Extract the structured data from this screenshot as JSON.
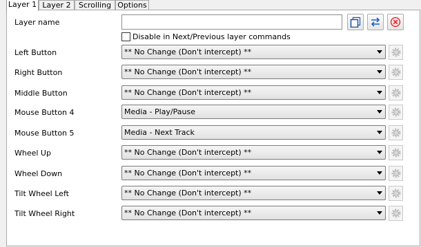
{
  "tabs": [
    "Layer 1",
    "Layer 2",
    "Scrolling",
    "Options"
  ],
  "layer_name": {
    "label": "Layer name",
    "value": "",
    "checkbox_label": "Disable in Next/Previous layer commands",
    "checked": false
  },
  "toolbar_icons": [
    "copy-icon",
    "swap-icon",
    "delete-icon"
  ],
  "rows": [
    {
      "label": "Left Button",
      "value": "** No Change (Don't intercept) **"
    },
    {
      "label": "Right Button",
      "value": "** No Change (Don't intercept) **"
    },
    {
      "label": "Middle Button",
      "value": "** No Change (Don't intercept) **"
    },
    {
      "label": "Mouse Button 4",
      "value": "Media - Play/Pause"
    },
    {
      "label": "Mouse Button 5",
      "value": "Media - Next Track"
    },
    {
      "label": "Wheel Up",
      "value": "** No Change (Don't intercept) **"
    },
    {
      "label": "Wheel Down",
      "value": "** No Change (Don't intercept) **"
    },
    {
      "label": "Tilt Wheel Left",
      "value": "** No Change (Don't intercept) **"
    },
    {
      "label": "Tilt Wheel Right",
      "value": "** No Change (Don't intercept) **"
    }
  ]
}
